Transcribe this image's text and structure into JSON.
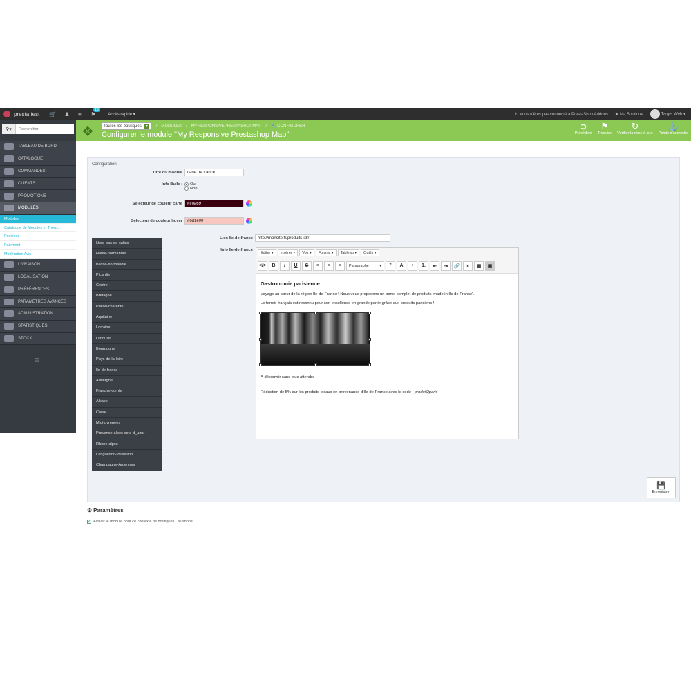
{
  "topbar": {
    "shop_name": "presta test",
    "notifications_count": "15",
    "quick_access": "Accès rapide",
    "addons_status": "Vous n'êtes pas connecté à PrestaShop Addons",
    "my_shop": "Ma Boutique",
    "user": "Target Web"
  },
  "search": {
    "placeholder": "Rechercher"
  },
  "sidebar": {
    "items": [
      {
        "label": "TABLEAU DE BORD"
      },
      {
        "label": "CATALOGUE"
      },
      {
        "label": "COMMANDES"
      },
      {
        "label": "CLIENTS"
      },
      {
        "label": "PROMOTIONS"
      },
      {
        "label": "MODULES"
      }
    ],
    "subitems": [
      {
        "label": "Modules"
      },
      {
        "label": "Catalogue de Modules et Thèm..."
      },
      {
        "label": "Positions"
      },
      {
        "label": "Paiement"
      },
      {
        "label": "Modération Avis"
      }
    ],
    "items2": [
      {
        "label": "LIVRAISON"
      },
      {
        "label": "LOCALISATION"
      },
      {
        "label": "PRÉFÉRENCES"
      },
      {
        "label": "PARAMÈTRES AVANCÉS"
      },
      {
        "label": "ADMINISTRATION"
      },
      {
        "label": "STATISTIQUES"
      },
      {
        "label": "STOCK"
      }
    ]
  },
  "header": {
    "shop_selector": "Toutes les boutiques",
    "crumb_modules": "MODULES",
    "crumb_module": "MYRESPONSIVEPRESTASHOPMAP",
    "crumb_configure": "CONFIGURER",
    "title": "Configurer le module \"My Responsive Prestashop Map\"",
    "tools": [
      {
        "label": "Précédent"
      },
      {
        "label": "Traduire"
      },
      {
        "label": "Vérifier la mise à jour"
      },
      {
        "label": "Points d'accroche"
      }
    ]
  },
  "form": {
    "section": "Configuration",
    "title_label": "Titre du module",
    "title_value": "carte de france",
    "bubble_label": "Info Bulle :",
    "bubble_yes": "Oui",
    "bubble_no": "Non",
    "map_color_label": "Selecteur de couleur carte",
    "map_color_value": "#ff0a69",
    "hover_color_label": "Selecteur de couleur hover",
    "hover_color_value": "#6d1e00",
    "link_label": "Lien Ile-de-france",
    "link_value": "http://monsite.fr/produits-idf/",
    "info_label": "Info Ile-de-france"
  },
  "colors": {
    "map_swatch": "#3a0010",
    "hover_swatch": "#f8c8c0"
  },
  "regions": [
    "Nord-pas-de-calais",
    "Haute-normandie",
    "Basse-normandie",
    "Picardie",
    "Centre",
    "Bretagne",
    "Poitou-charente",
    "Aquitaine",
    "Lorraine",
    "Limousin",
    "Bourgogne",
    "Pays-de-la-loire",
    "Ile-de-france",
    "Auvergne",
    "Franche-comte",
    "Alsace",
    "Corse",
    "Midi-pyrenees",
    "Provence-alpes-cote-d_azur",
    "Rhone-alpes",
    "Languedoc-roussillon",
    "Champagne-Ardennes"
  ],
  "editor": {
    "menus": [
      "Editer",
      "Insérer",
      "Voir",
      "Format",
      "Tableau",
      "Outils"
    ],
    "paragraph": "Paragraphe",
    "heading": "Gastronomie parisienne",
    "p1": "Voyage au cœur de la région Ile-de-France ! Nous vous proposons un panel complet de produits 'made in Ile de France'.",
    "p2": "Le terroir français est reconnu pour son excellence en grande partie grâce aux produits parisiens !",
    "p3": "À découvrir sans plus attendre !",
    "p4": "Réduction de 5% sur les produits locaux en provenance d'Ile-de-France avec le code :",
    "code": "produit2paris"
  },
  "save": {
    "label": "Enregistrer"
  },
  "params": {
    "title": "Paramètres",
    "shops_text": "Activer le module pour ce contexte de boutiques : all shops."
  }
}
